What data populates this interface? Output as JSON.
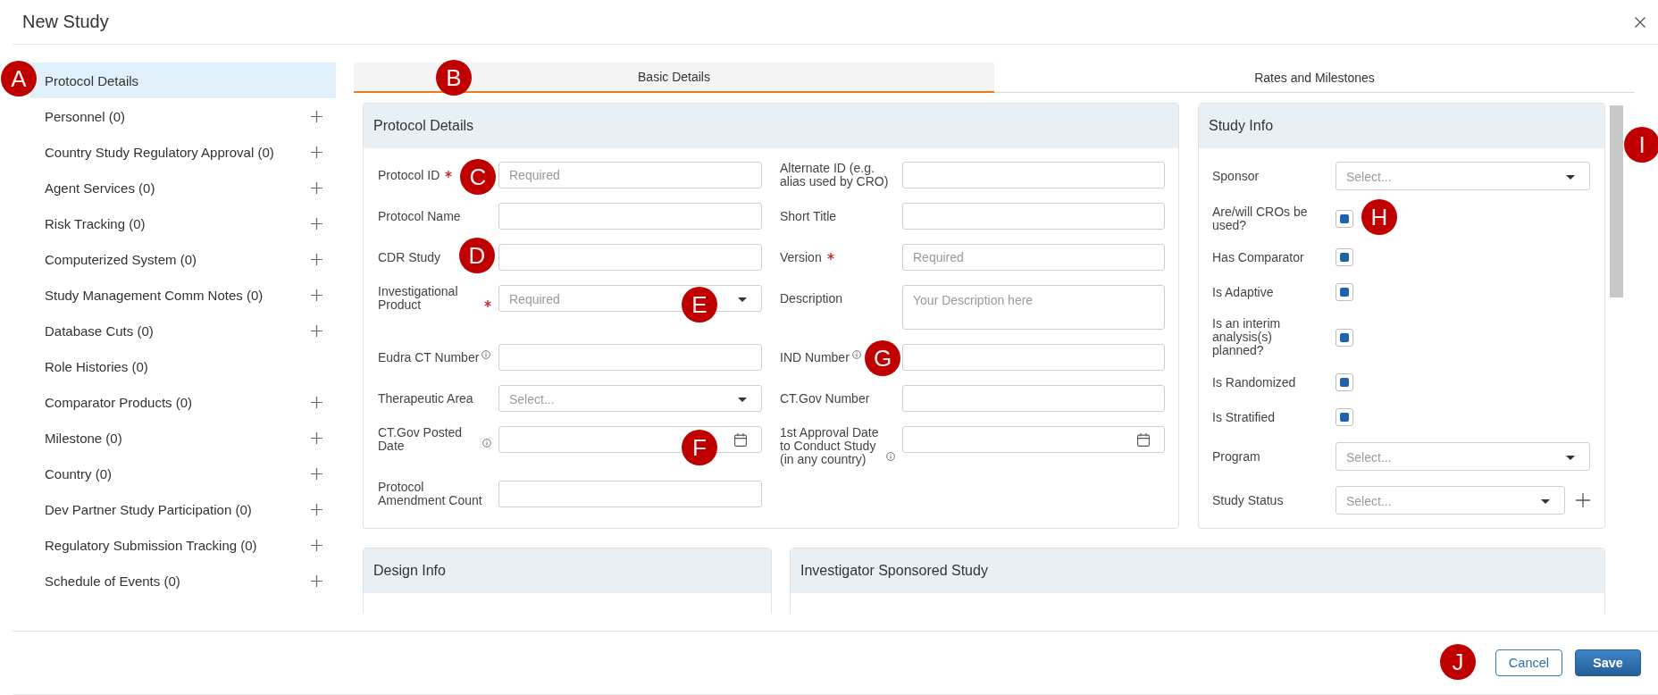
{
  "window": {
    "title": "New Study"
  },
  "sidebar": {
    "items": [
      {
        "label": "Protocol Details",
        "selected": true,
        "addable": false
      },
      {
        "label": "Personnel (0)",
        "selected": false,
        "addable": true
      },
      {
        "label": "Country Study Regulatory Approval (0)",
        "selected": false,
        "addable": true
      },
      {
        "label": "Agent Services (0)",
        "selected": false,
        "addable": true
      },
      {
        "label": "Risk Tracking (0)",
        "selected": false,
        "addable": true
      },
      {
        "label": "Computerized System (0)",
        "selected": false,
        "addable": true
      },
      {
        "label": "Study Management Comm Notes (0)",
        "selected": false,
        "addable": true
      },
      {
        "label": "Database Cuts (0)",
        "selected": false,
        "addable": true
      },
      {
        "label": "Role Histories (0)",
        "selected": false,
        "addable": false
      },
      {
        "label": "Comparator Products (0)",
        "selected": false,
        "addable": true
      },
      {
        "label": "Milestone (0)",
        "selected": false,
        "addable": true
      },
      {
        "label": "Country (0)",
        "selected": false,
        "addable": true
      },
      {
        "label": "Dev Partner Study Participation (0)",
        "selected": false,
        "addable": true
      },
      {
        "label": "Regulatory Submission Tracking (0)",
        "selected": false,
        "addable": true
      },
      {
        "label": "Schedule of Events (0)",
        "selected": false,
        "addable": true
      }
    ]
  },
  "tabs": [
    {
      "label": "Basic Details",
      "selected": true
    },
    {
      "label": "Rates and Milestones",
      "selected": false
    }
  ],
  "protocol_details": {
    "title": "Protocol Details",
    "fields": [
      {
        "label": "Protocol ID",
        "kind": "text",
        "required": true,
        "info": false,
        "placeholder": "Required"
      },
      {
        "label": "Alternate ID (e.g. alias used by CRO)",
        "kind": "text",
        "required": false,
        "info": false
      },
      {
        "label": "Protocol Name",
        "kind": "text",
        "required": false,
        "info": false
      },
      {
        "label": "Short Title",
        "kind": "text",
        "required": false,
        "info": false
      },
      {
        "label": "CDR Study",
        "kind": "text",
        "required": false,
        "info": false
      },
      {
        "label": "Version",
        "kind": "text",
        "required": true,
        "info": false,
        "placeholder": "Required"
      },
      {
        "label": "Investigational Product",
        "kind": "select",
        "required": true,
        "info": false,
        "placeholder": "Required"
      },
      {
        "label": "Description",
        "kind": "textarea",
        "required": false,
        "info": false,
        "placeholder": "Your Description here"
      },
      {
        "label": "Eudra CT Number",
        "kind": "text",
        "required": false,
        "info": true
      },
      {
        "label": "IND Number",
        "kind": "text",
        "required": false,
        "info": true
      },
      {
        "label": "Therapeutic Area",
        "kind": "select",
        "required": false,
        "info": false,
        "placeholder": "Select..."
      },
      {
        "label": "CT.Gov Number",
        "kind": "text",
        "required": false,
        "info": false
      },
      {
        "label": "CT.Gov Posted Date",
        "kind": "date",
        "required": false,
        "info": true
      },
      {
        "label": "1st Approval Date to Conduct Study (in any country)",
        "kind": "date",
        "required": false,
        "info": true
      },
      {
        "label": "Protocol Amendment Count",
        "kind": "text",
        "required": false,
        "info": false
      }
    ]
  },
  "study_info": {
    "title": "Study Info",
    "fields": [
      {
        "label": "Sponsor",
        "kind": "select",
        "placeholder": "Select...",
        "addable": false
      },
      {
        "label": "Are/will CROs be used?",
        "kind": "checkbox",
        "checked": true,
        "addable": false
      },
      {
        "label": "Has Comparator",
        "kind": "checkbox",
        "checked": true,
        "addable": false
      },
      {
        "label": "Is Adaptive",
        "kind": "checkbox",
        "checked": true,
        "addable": false
      },
      {
        "label": "Is an interim analysis(s) planned?",
        "kind": "checkbox",
        "checked": true,
        "addable": false
      },
      {
        "label": "Is Randomized",
        "kind": "checkbox",
        "checked": true,
        "addable": false
      },
      {
        "label": "Is Stratified",
        "kind": "checkbox",
        "checked": true,
        "addable": false
      },
      {
        "label": "Program",
        "kind": "select",
        "placeholder": "Select...",
        "addable": false
      },
      {
        "label": "Study Status",
        "kind": "select",
        "placeholder": "Select...",
        "addable": true
      }
    ]
  },
  "sections": [
    {
      "title": "Design Info"
    },
    {
      "title": "Investigator Sponsored Study"
    }
  ],
  "footer": {
    "buttons": [
      {
        "label": "Cancel",
        "kind": "secondary"
      },
      {
        "label": "Save",
        "kind": "primary"
      }
    ]
  },
  "callouts": [
    {
      "label": "A"
    },
    {
      "label": "B"
    },
    {
      "label": "C"
    },
    {
      "label": "D"
    },
    {
      "label": "E"
    },
    {
      "label": "F"
    },
    {
      "label": "G"
    },
    {
      "label": "H"
    },
    {
      "label": "I"
    },
    {
      "label": "J"
    }
  ]
}
